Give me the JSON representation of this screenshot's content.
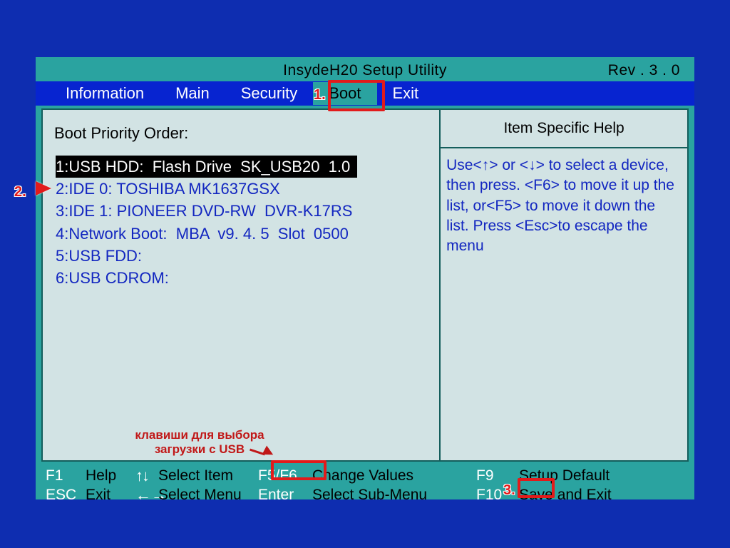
{
  "header": {
    "title": "InsydeH20  Setup  Utility",
    "revision": "Rev . 3 . 0"
  },
  "tabs": [
    {
      "label": "Information",
      "active": false
    },
    {
      "label": "Main",
      "active": false
    },
    {
      "label": "Security",
      "active": false
    },
    {
      "label": "Boot",
      "active": true
    },
    {
      "label": "Exit",
      "active": false
    }
  ],
  "main": {
    "section_title": "Boot Priority Order:",
    "boot_items": [
      {
        "label": "1:USB HDD:  Flash Drive  SK_USB20  1.0",
        "selected": true
      },
      {
        "label": "2:IDE 0: TOSHIBA MK1637GSX",
        "selected": false
      },
      {
        "label": "3:IDE 1: PIONEER DVD-RW  DVR-K17RS",
        "selected": false
      },
      {
        "label": "4:Network Boot:  MBA  v9. 4. 5  Slot  0500",
        "selected": false
      },
      {
        "label": "5:USB FDD:",
        "selected": false
      },
      {
        "label": "6:USB CDROM:",
        "selected": false
      }
    ]
  },
  "help": {
    "header": "Item Specific Help",
    "body": "Use<↑> or <↓> to select a device,  then press. <F6> to move it up the list, or<F5> to move it down the list. Press <Esc>to escape the menu"
  },
  "footer": {
    "f1": "F1",
    "help": "Help",
    "select_item": "Select Item",
    "f5f6": "F5/F6",
    "change_values": "Change Values",
    "f9": "F9",
    "setup_default": "Setup Default",
    "esc": "ESC",
    "exit": "Exit",
    "select_menu": "Select Menu",
    "enter": "Enter",
    "select_sub": "Select  Sub-Menu",
    "f10": "F10",
    "save_exit": "Save and Exit"
  },
  "annotations": {
    "marker1": "1.",
    "marker2": "2.",
    "marker3": "3.",
    "usb_hint": "клавиши для выбора\nзагрузки с USB"
  }
}
